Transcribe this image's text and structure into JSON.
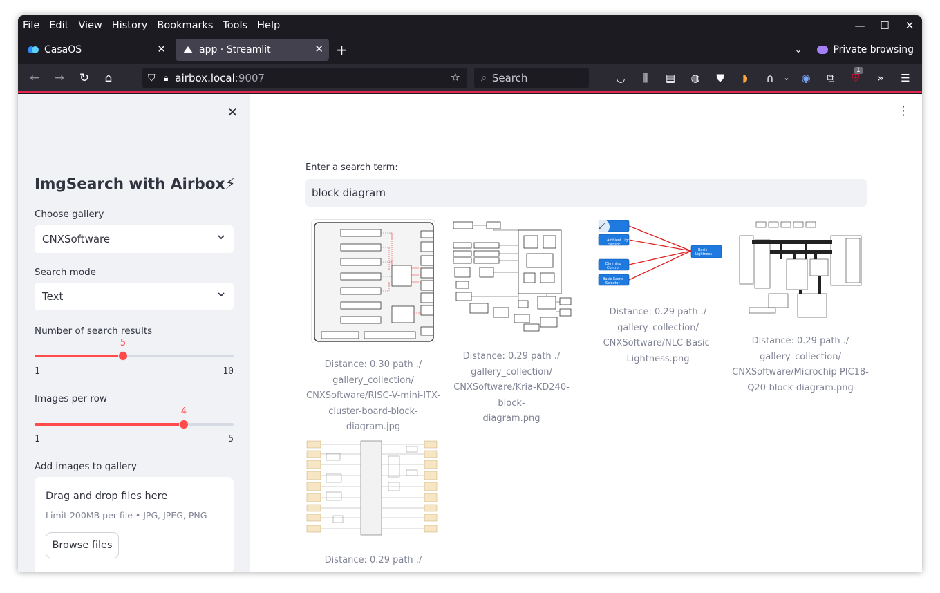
{
  "menubar": [
    "File",
    "Edit",
    "View",
    "History",
    "Bookmarks",
    "Tools",
    "Help"
  ],
  "tabs": [
    {
      "title": "CasaOS",
      "active": false
    },
    {
      "title": "app · Streamlit",
      "active": true
    }
  ],
  "private_label": "Private browsing",
  "url": {
    "host": "airbox.local",
    "port": ":9007"
  },
  "search_placeholder": "Search",
  "badge_count": "1",
  "sidebar": {
    "title": "ImgSearch with Airbox⚡",
    "gallery_label": "Choose gallery",
    "gallery_value": "CNXSoftware",
    "mode_label": "Search mode",
    "mode_value": "Text",
    "results_label": "Number of search results",
    "results": {
      "value": 5,
      "min": 1,
      "max": 10,
      "min_label": "1",
      "max_label": "10",
      "value_label": "5"
    },
    "perrow_label": "Images per row",
    "perrow": {
      "value": 4,
      "min": 1,
      "max": 5,
      "min_label": "1",
      "max_label": "5",
      "value_label": "4"
    },
    "upload_label": "Add images to gallery",
    "upload_title": "Drag and drop files here",
    "upload_limit": "Limit 200MB per file • JPG, JPEG, PNG",
    "browse_label": "Browse files"
  },
  "main": {
    "query_label": "Enter a search term:",
    "query_value": "block diagram",
    "results": [
      {
        "lines": [
          "Distance: 0.30 path ./",
          "gallery_collection/",
          "CNXSoftware/RISC-V-mini-ITX-",
          "cluster-board-block-",
          "diagram.jpg"
        ]
      },
      {
        "lines": [
          "Distance: 0.29 path ./",
          "gallery_collection/",
          "CNXSoftware/Kria-KD240-block-",
          "diagram.png"
        ]
      },
      {
        "lines": [
          "Distance: 0.29 path ./",
          "gallery_collection/",
          "CNXSoftware/NLC-Basic-",
          "Lightness.png"
        ]
      },
      {
        "lines": [
          "Distance: 0.29 path ./",
          "gallery_collection/",
          "CNXSoftware/Microchip PIC18-",
          "Q20-block-diagram.png"
        ]
      },
      {
        "lines": [
          "Distance: 0.29 path ./",
          "gallery_collection/"
        ]
      }
    ]
  },
  "colors": {
    "accent": "#ff4b4b",
    "browser_bg": "#1c1b22",
    "sidebar_bg": "#f0f2f6"
  }
}
